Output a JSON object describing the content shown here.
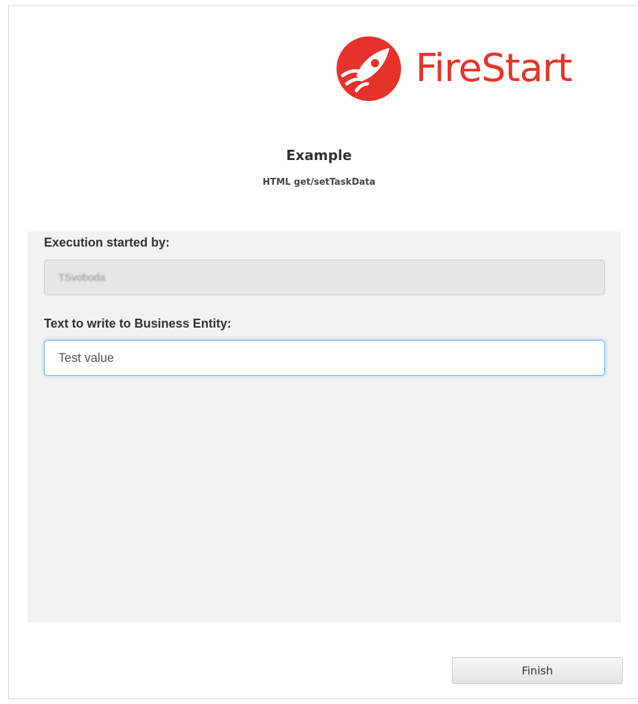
{
  "brand": {
    "name": "FireStart",
    "color": "#e5332a",
    "logo_icon": "rocket-icon"
  },
  "header": {
    "title": "Example",
    "subtitle": "HTML get/setTaskData"
  },
  "form": {
    "started_by": {
      "label": "Execution started by:",
      "value": "TSvoboda"
    },
    "entity_text": {
      "label": "Text to write to Business Entity:",
      "value": "Test value"
    }
  },
  "actions": {
    "finish_label": "Finish"
  }
}
